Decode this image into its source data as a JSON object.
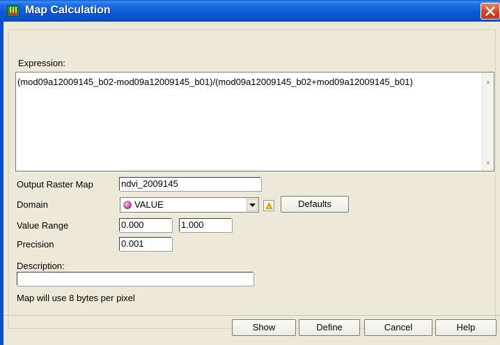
{
  "window": {
    "title": "Map Calculation",
    "icon": "app-grid-icon",
    "close_icon": "close-icon"
  },
  "expression": {
    "label": "Expression:",
    "value": "(mod09a12009145_b02-mod09a12009145_b01)/(mod09a12009145_b02+mod09a12009145_b01)"
  },
  "output_map": {
    "label": "Output Raster Map",
    "value": "ndvi_2009145"
  },
  "domain": {
    "label": "Domain",
    "value": "VALUE",
    "icon": "value-domain-icon"
  },
  "value_range": {
    "label": "Value Range",
    "min": "0.000",
    "max": "1.000"
  },
  "precision": {
    "label": "Precision",
    "value": "0.001"
  },
  "description": {
    "label": "Description:",
    "value": ""
  },
  "info": "Map will use 8 bytes per pixel",
  "buttons": {
    "defaults": "Defaults",
    "show": "Show",
    "define": "Define",
    "cancel": "Cancel",
    "help": "Help"
  },
  "colors": {
    "titlebar": "#0b52cb",
    "dialog_bg": "#ece9d8",
    "close_button": "#d3431f"
  }
}
